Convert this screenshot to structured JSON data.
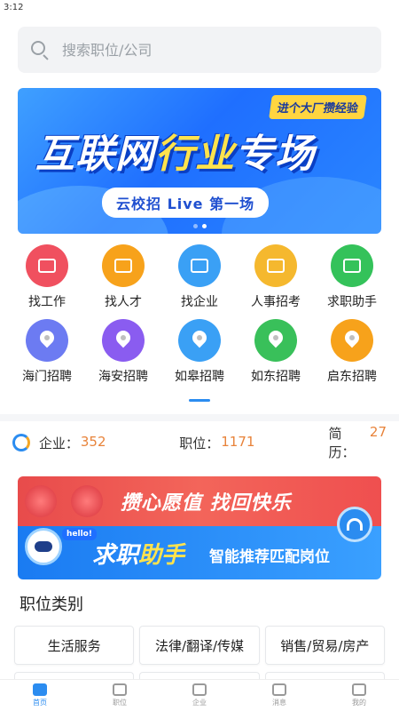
{
  "status_bar": {
    "time": "3:12"
  },
  "search": {
    "placeholder": "搜索职位/公司",
    "icon": "search-icon"
  },
  "banner": {
    "tag": "进个大厂攒经验",
    "title_part1": "互联网",
    "title_part2": "行业",
    "title_part3": "专场",
    "subtitle": "云校招 Live 第一场",
    "slide_count": 2,
    "active_slide": 2
  },
  "quick_menu": [
    {
      "label": "找工作",
      "icon": "briefcase-icon",
      "color": "#f0505f"
    },
    {
      "label": "找人才",
      "icon": "person-icon",
      "color": "#f7a21b"
    },
    {
      "label": "找企业",
      "icon": "building-icon",
      "color": "#3aa0f5"
    },
    {
      "label": "人事招考",
      "icon": "document-icon",
      "color": "#f5b82e"
    },
    {
      "label": "求职助手",
      "icon": "robot-icon",
      "color": "#34c25a"
    },
    {
      "label": "海门招聘",
      "icon": "location-pin-icon",
      "color": "#6c7bf2"
    },
    {
      "label": "海安招聘",
      "icon": "location-pin-icon",
      "color": "#8a5cf0"
    },
    {
      "label": "如皋招聘",
      "icon": "location-pin-icon",
      "color": "#3aa0f5"
    },
    {
      "label": "如东招聘",
      "icon": "location-pin-icon",
      "color": "#39c05a"
    },
    {
      "label": "启东招聘",
      "icon": "location-pin-icon",
      "color": "#f7a21b"
    }
  ],
  "stats": {
    "company_label": "企业：",
    "company_value": "352",
    "job_label": "职位：",
    "job_value": "1171",
    "resume_label": "简历：",
    "resume_value": "27"
  },
  "ads": {
    "top_text": "攒心愿值 找回快乐",
    "bottom_hello": "hello!",
    "bottom_big_1": "求职",
    "bottom_big_2": "助手",
    "bottom_small": "智能推荐匹配岗位"
  },
  "categories": {
    "title": "职位类别",
    "items": [
      "生活服务",
      "法律/翻译/传媒",
      "销售/贸易/房产"
    ]
  },
  "tabbar": [
    {
      "label": "首页",
      "icon": "home-icon",
      "active": true
    },
    {
      "label": "职位",
      "icon": "briefcase-icon",
      "active": false
    },
    {
      "label": "企业",
      "icon": "building-icon",
      "active": false
    },
    {
      "label": "消息",
      "icon": "message-icon",
      "active": false
    },
    {
      "label": "我的",
      "icon": "profile-icon",
      "active": false
    }
  ],
  "colors": {
    "accent": "#2b8cf0",
    "stat_number": "#e8833a"
  }
}
